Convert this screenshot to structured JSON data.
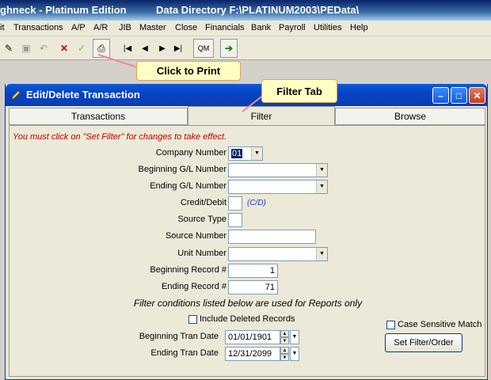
{
  "app": {
    "title": "ghneck - Platinum Edition",
    "directory": "Data Directory  F:\\PLATINUM2003\\PEData\\"
  },
  "menu": {
    "items": [
      "it",
      "Transactions",
      "A/P",
      "A/R",
      "JIB",
      "Master",
      "Close",
      "Financials",
      "Bank",
      "Payroll",
      "Utilities",
      "Help"
    ]
  },
  "toolbar": {
    "icons": [
      "edit-icon",
      "save-icon",
      "undo-icon",
      "delete-icon",
      "check-icon",
      "print-icon",
      "first-record-icon",
      "previous-record-icon",
      "next-record-icon",
      "last-record-icon",
      "exit-icon"
    ],
    "qm_label": "QM"
  },
  "callouts": {
    "print": "Click to Print",
    "filter_tab": "Filter Tab"
  },
  "dialog": {
    "title": "Edit/Delete Transaction",
    "tabs": [
      "Transactions",
      "Filter",
      "Browse"
    ],
    "active_tab": "Filter",
    "warning": "You must click on \"Set Filter\" for changes to take effect.",
    "fields": {
      "company_number": {
        "label": "Company Number",
        "value": "01"
      },
      "beginning_gl": {
        "label": "Beginning G/L Number",
        "value": ""
      },
      "ending_gl": {
        "label": "Ending G/L Number",
        "value": ""
      },
      "credit_debit": {
        "label": "Credit/Debit",
        "value": "",
        "hint": "(C/D)"
      },
      "source_type": {
        "label": "Source Type",
        "value": ""
      },
      "source_number": {
        "label": "Source Number",
        "value": ""
      },
      "unit_number": {
        "label": "Unit Number",
        "value": ""
      },
      "beginning_record": {
        "label": "Beginning Record #",
        "value": "1"
      },
      "ending_record": {
        "label": "Ending Record #",
        "value": "71"
      },
      "beginning_tran_date": {
        "label": "Beginning Tran Date",
        "value": "01/01/1901"
      },
      "ending_tran_date": {
        "label": "Ending Tran Date",
        "value": "12/31/2099"
      }
    },
    "note": "Filter conditions listed below are used for Reports only",
    "include_deleted": {
      "label": "Include Deleted Records",
      "checked": false
    },
    "case_sensitive": {
      "label": "Case Sensitive Match",
      "checked": false
    },
    "set_filter_button": "Set Filter/Order"
  }
}
